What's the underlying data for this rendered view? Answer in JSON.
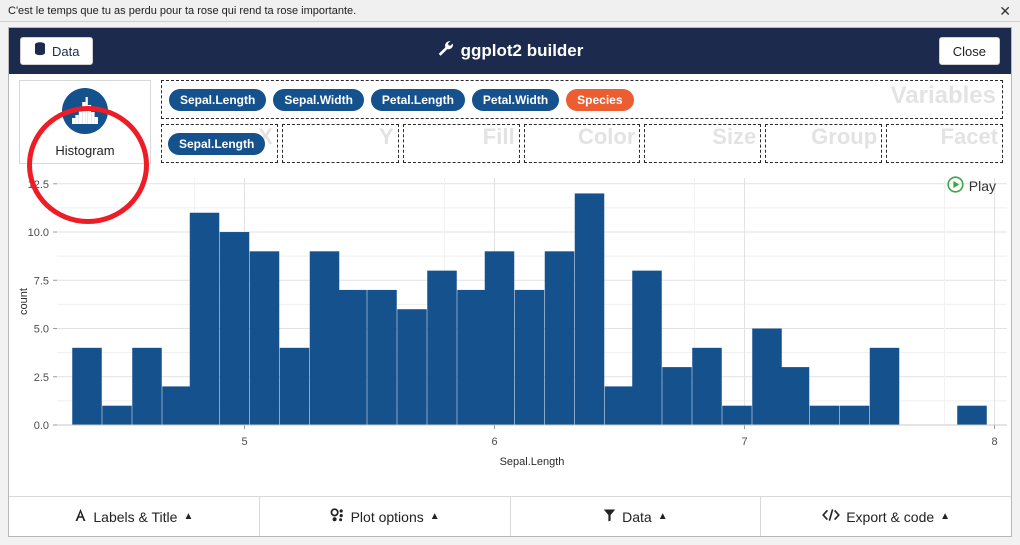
{
  "notice": {
    "text": "C'est le temps que tu as perdu pour ta rose qui rend ta rose importante.",
    "close_glyph": "✕"
  },
  "header": {
    "data_button_label": "Data",
    "data_button_icon": "database-icon",
    "title": "ggplot2 builder",
    "title_icon": "wrench-icon",
    "close_label": "Close"
  },
  "geom": {
    "label": "Histogram",
    "icon": "histogram-icon"
  },
  "variables": {
    "panel_title": "Variables",
    "items": [
      {
        "label": "Sepal.Length",
        "color": "#14518d"
      },
      {
        "label": "Sepal.Width",
        "color": "#14518d"
      },
      {
        "label": "Petal.Length",
        "color": "#14518d"
      },
      {
        "label": "Petal.Width",
        "color": "#14518d"
      },
      {
        "label": "Species",
        "color": "#ec5d32"
      }
    ]
  },
  "aesthetics": [
    {
      "zone": "X",
      "value": "Sepal.Length"
    },
    {
      "zone": "Y",
      "value": ""
    },
    {
      "zone": "Fill",
      "value": ""
    },
    {
      "zone": "Color",
      "value": ""
    },
    {
      "zone": "Size",
      "value": ""
    },
    {
      "zone": "Group",
      "value": ""
    },
    {
      "zone": "Facet",
      "value": ""
    }
  ],
  "play": {
    "label": "Play",
    "icon": "play-circle-icon",
    "color": "#3fa34d"
  },
  "bottom_toolbar": [
    {
      "label": "Labels & Title",
      "icon": "font-icon",
      "caret": "▲"
    },
    {
      "label": "Plot options",
      "icon": "sliders-icon",
      "caret": "▲"
    },
    {
      "label": "Data",
      "icon": "filter-icon",
      "caret": "▲"
    },
    {
      "label": "Export & code",
      "icon": "code-icon",
      "caret": "▲"
    }
  ],
  "chart_data": {
    "type": "bar",
    "title": "",
    "xlabel": "Sepal.Length",
    "ylabel": "count",
    "bar_color": "#14518d",
    "grid": true,
    "legend": "none",
    "xlim": [
      4.25,
      8.05
    ],
    "ylim": [
      0,
      12.8
    ],
    "xticks": [
      "5",
      "6",
      "7",
      "8"
    ],
    "xtick_values": [
      5,
      6,
      7,
      8
    ],
    "yticks": [
      "0.0",
      "2.5",
      "5.0",
      "7.5",
      "10.0",
      "12.5"
    ],
    "ytick_values": [
      0,
      2.5,
      5,
      7.5,
      10,
      12.5
    ],
    "bin_width": 0.118,
    "x": [
      4.37,
      4.49,
      4.61,
      4.73,
      4.84,
      4.96,
      5.08,
      5.2,
      5.32,
      5.43,
      5.55,
      5.67,
      5.79,
      5.91,
      6.02,
      6.14,
      6.26,
      6.38,
      6.5,
      6.61,
      6.73,
      6.85,
      6.97,
      7.09,
      7.2,
      7.32,
      7.44,
      7.56,
      7.67,
      7.79,
      7.91
    ],
    "values": [
      4,
      1,
      4,
      2,
      11,
      10,
      9,
      4,
      9,
      7,
      7,
      6,
      8,
      7,
      9,
      7,
      9,
      12,
      2,
      8,
      3,
      4,
      1,
      5,
      3,
      1,
      1,
      4,
      0,
      0,
      1
    ],
    "categories": [
      "4.37",
      "4.49",
      "4.61",
      "4.73",
      "4.84",
      "4.96",
      "5.08",
      "5.20",
      "5.32",
      "5.43",
      "5.55",
      "5.67",
      "5.79",
      "5.91",
      "6.02",
      "6.14",
      "6.26",
      "6.38",
      "6.50",
      "6.61",
      "6.73",
      "6.85",
      "6.97",
      "7.09",
      "7.20",
      "7.32",
      "7.44",
      "7.56",
      "7.67",
      "7.79",
      "7.91"
    ]
  }
}
